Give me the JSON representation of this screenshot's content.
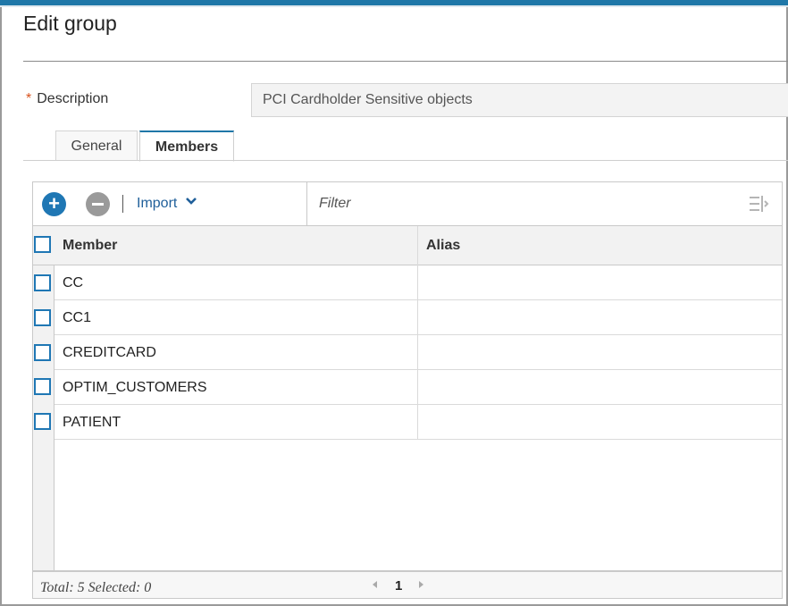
{
  "dialog": {
    "title": "Edit group",
    "description_label": "Description",
    "required_marker": "*",
    "description_value": "PCI Cardholder Sensitive objects"
  },
  "tabs": [
    {
      "label": "General",
      "active": false
    },
    {
      "label": "Members",
      "active": true
    }
  ],
  "toolbar": {
    "add_icon": "plus-circle-icon",
    "add_glyph": "+",
    "remove_icon": "minus-circle-icon",
    "import_label": "Import",
    "filter_placeholder": "Filter",
    "filter_options_icon": "filter-settings-icon"
  },
  "table": {
    "columns": [
      "Member",
      "Alias"
    ],
    "rows": [
      {
        "member": "CC",
        "alias": ""
      },
      {
        "member": "CC1",
        "alias": ""
      },
      {
        "member": "CREDITCARD",
        "alias": ""
      },
      {
        "member": "OPTIM_CUSTOMERS",
        "alias": ""
      },
      {
        "member": "PATIENT",
        "alias": ""
      }
    ]
  },
  "footer": {
    "status": "Total: 5 Selected: 0",
    "current_page": "1"
  },
  "colors": {
    "accent": "#1f77b4",
    "required": "#d9531e",
    "header_bar": "#1f77a8"
  }
}
